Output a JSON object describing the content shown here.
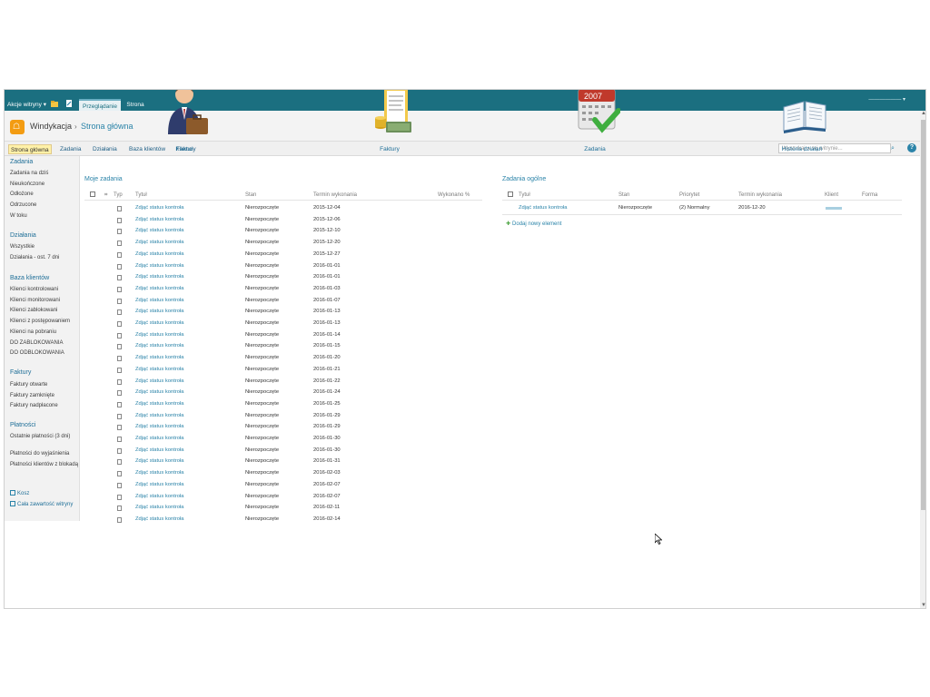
{
  "ribbon": {
    "site_actions": "Akcje witryny",
    "tab_browse": "Przeglądanie",
    "tab_page": "Strona",
    "user": "——————"
  },
  "header": {
    "site_title": "Windykacja",
    "crumb_sep": "›",
    "crumb_current": "Strona główna"
  },
  "topnav": {
    "items": [
      {
        "label": "Strona główna"
      },
      {
        "label": "Zadania"
      },
      {
        "label": "Działania"
      },
      {
        "label": "Baza klientów"
      },
      {
        "label": "Faktury"
      }
    ],
    "search_placeholder": "Wyszukaj w tej witrynie...",
    "help": "?"
  },
  "leftnav": {
    "sections": [
      {
        "heading": "Zadania",
        "items": [
          "Zadania na dziś",
          "Nieukończone",
          "Odłożone",
          "Odrzucone",
          "W toku"
        ]
      },
      {
        "heading": "Działania",
        "items": [
          "Wszystkie",
          "Działania - ost. 7 dni"
        ]
      },
      {
        "heading": "Baza klientów",
        "items": [
          "Klienci kontrolowani",
          "Klienci monitorowani",
          "Klienci zablokowani",
          "Klienci z postępowaniem",
          "Klienci na pobraniu",
          "DO ZABLOKOWANIA",
          "DO ODBLOKOWANIA"
        ]
      },
      {
        "heading": "Faktury",
        "items": [
          "Faktury otwarte",
          "Faktury zamknięte",
          "Faktury nadpłacone"
        ]
      },
      {
        "heading": "Płatności",
        "items": [
          "Ostatnie płatności (3 dni)",
          "Płatności do wyjaśnienia",
          "Płatności klientów z blokadą"
        ]
      }
    ],
    "recycle": "Kosz",
    "all_content": "Cała zawartość witryny"
  },
  "quick_links": [
    {
      "label": "Klienci"
    },
    {
      "label": "Faktury"
    },
    {
      "label": "Zadania"
    },
    {
      "label": "Historia działań"
    }
  ],
  "calendar_year": "2007",
  "my_tasks": {
    "title": "Moje zadania",
    "columns": [
      "Typ",
      "Tytuł",
      "Stan",
      "Termin wykonania",
      "Wykonano %"
    ],
    "rows": [
      {
        "title": "Zdjąć status kontroła",
        "status": "Nierozpoczęte",
        "due": "2015-12-04"
      },
      {
        "title": "Zdjąć status kontroła",
        "status": "Nierozpoczęte",
        "due": "2015-12-06"
      },
      {
        "title": "Zdjąć status kontroła",
        "status": "Nierozpoczęte",
        "due": "2015-12-10"
      },
      {
        "title": "Zdjąć status kontroła",
        "status": "Nierozpoczęte",
        "due": "2015-12-20"
      },
      {
        "title": "Zdjąć status kontroła",
        "status": "Nierozpoczęte",
        "due": "2015-12-27"
      },
      {
        "title": "Zdjąć status kontroła",
        "status": "Nierozpoczęte",
        "due": "2016-01-01"
      },
      {
        "title": "Zdjąć status kontroła",
        "status": "Nierozpoczęte",
        "due": "2016-01-01"
      },
      {
        "title": "Zdjąć status kontroła",
        "status": "Nierozpoczęte",
        "due": "2016-01-03"
      },
      {
        "title": "Zdjąć status kontroła",
        "status": "Nierozpoczęte",
        "due": "2016-01-07"
      },
      {
        "title": "Zdjąć status kontroła",
        "status": "Nierozpoczęte",
        "due": "2016-01-13"
      },
      {
        "title": "Zdjąć status kontroła",
        "status": "Nierozpoczęte",
        "due": "2016-01-13"
      },
      {
        "title": "Zdjąć status kontroła",
        "status": "Nierozpoczęte",
        "due": "2016-01-14"
      },
      {
        "title": "Zdjąć status kontroła",
        "status": "Nierozpoczęte",
        "due": "2016-01-15"
      },
      {
        "title": "Zdjąć status kontroła",
        "status": "Nierozpoczęte",
        "due": "2016-01-20"
      },
      {
        "title": "Zdjąć status kontroła",
        "status": "Nierozpoczęte",
        "due": "2016-01-21"
      },
      {
        "title": "Zdjąć status kontroła",
        "status": "Nierozpoczęte",
        "due": "2016-01-22"
      },
      {
        "title": "Zdjąć status kontroła",
        "status": "Nierozpoczęte",
        "due": "2016-01-24"
      },
      {
        "title": "Zdjąć status kontroła",
        "status": "Nierozpoczęte",
        "due": "2016-01-25"
      },
      {
        "title": "Zdjąć status kontroła",
        "status": "Nierozpoczęte",
        "due": "2016-01-29"
      },
      {
        "title": "Zdjąć status kontroła",
        "status": "Nierozpoczęte",
        "due": "2016-01-29"
      },
      {
        "title": "Zdjąć status kontroła",
        "status": "Nierozpoczęte",
        "due": "2016-01-30"
      },
      {
        "title": "Zdjąć status kontroła",
        "status": "Nierozpoczęte",
        "due": "2016-01-30"
      },
      {
        "title": "Zdjąć status kontroła",
        "status": "Nierozpoczęte",
        "due": "2016-01-31"
      },
      {
        "title": "Zdjąć status kontroła",
        "status": "Nierozpoczęte",
        "due": "2016-02-03"
      },
      {
        "title": "Zdjąć status kontroła",
        "status": "Nierozpoczęte",
        "due": "2016-02-07"
      },
      {
        "title": "Zdjąć status kontroła",
        "status": "Nierozpoczęte",
        "due": "2016-02-07"
      },
      {
        "title": "Zdjąć status kontroła",
        "status": "Nierozpoczęte",
        "due": "2016-02-11"
      },
      {
        "title": "Zdjąć status kontroła",
        "status": "Nierozpoczęte",
        "due": "2016-02-14"
      }
    ]
  },
  "general_tasks": {
    "title": "Zadania ogólne",
    "columns": [
      "Tytuł",
      "Stan",
      "Priorytet",
      "Termin wykonania",
      "Klient",
      "Forma"
    ],
    "rows": [
      {
        "title": "Zdjąć status kontroła",
        "status": "Nierozpoczęte",
        "priority": "(2) Normalny",
        "due": "2016-12-20"
      }
    ],
    "add_item": "Dodaj nowy element"
  },
  "colors": {
    "ribbon": "#1b6f80",
    "link": "#2a83a8",
    "active_nav": "#fff1a8"
  }
}
